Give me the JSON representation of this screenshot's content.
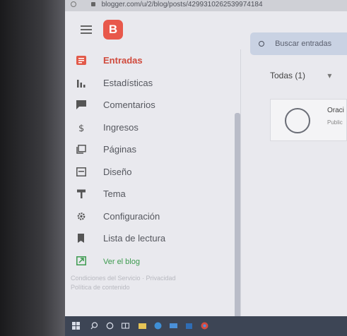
{
  "browser": {
    "url": "blogger.com/u/2/blog/posts/4299310262539974184"
  },
  "header": {
    "logo_letter": "B",
    "search_placeholder": "Buscar entradas"
  },
  "sidebar": {
    "items": [
      {
        "label": "Entradas",
        "icon": "posts-icon",
        "active": true
      },
      {
        "label": "Estadísticas",
        "icon": "stats-icon",
        "active": false
      },
      {
        "label": "Comentarios",
        "icon": "comments-icon",
        "active": false
      },
      {
        "label": "Ingresos",
        "icon": "dollar-icon",
        "active": false
      },
      {
        "label": "Páginas",
        "icon": "pages-icon",
        "active": false
      },
      {
        "label": "Diseño",
        "icon": "layout-icon",
        "active": false
      },
      {
        "label": "Tema",
        "icon": "theme-icon",
        "active": false
      },
      {
        "label": "Configuración",
        "icon": "gear-icon",
        "active": false
      },
      {
        "label": "Lista de lectura",
        "icon": "bookmark-icon",
        "active": false
      },
      {
        "label": "Ver el blog",
        "icon": "external-link-icon",
        "active": false
      }
    ],
    "footer_line1": "Condiciones del Servicio · Privacidad",
    "footer_line2": "Política de contenido"
  },
  "main": {
    "filter_tab": "Todas (1)",
    "post": {
      "title": "Oraci",
      "status": "Public"
    }
  },
  "colors": {
    "accent": "#d04a3c",
    "logo": "#e8584b",
    "search_bg": "#c9d2e3",
    "view_blog": "#3c9a4e"
  }
}
